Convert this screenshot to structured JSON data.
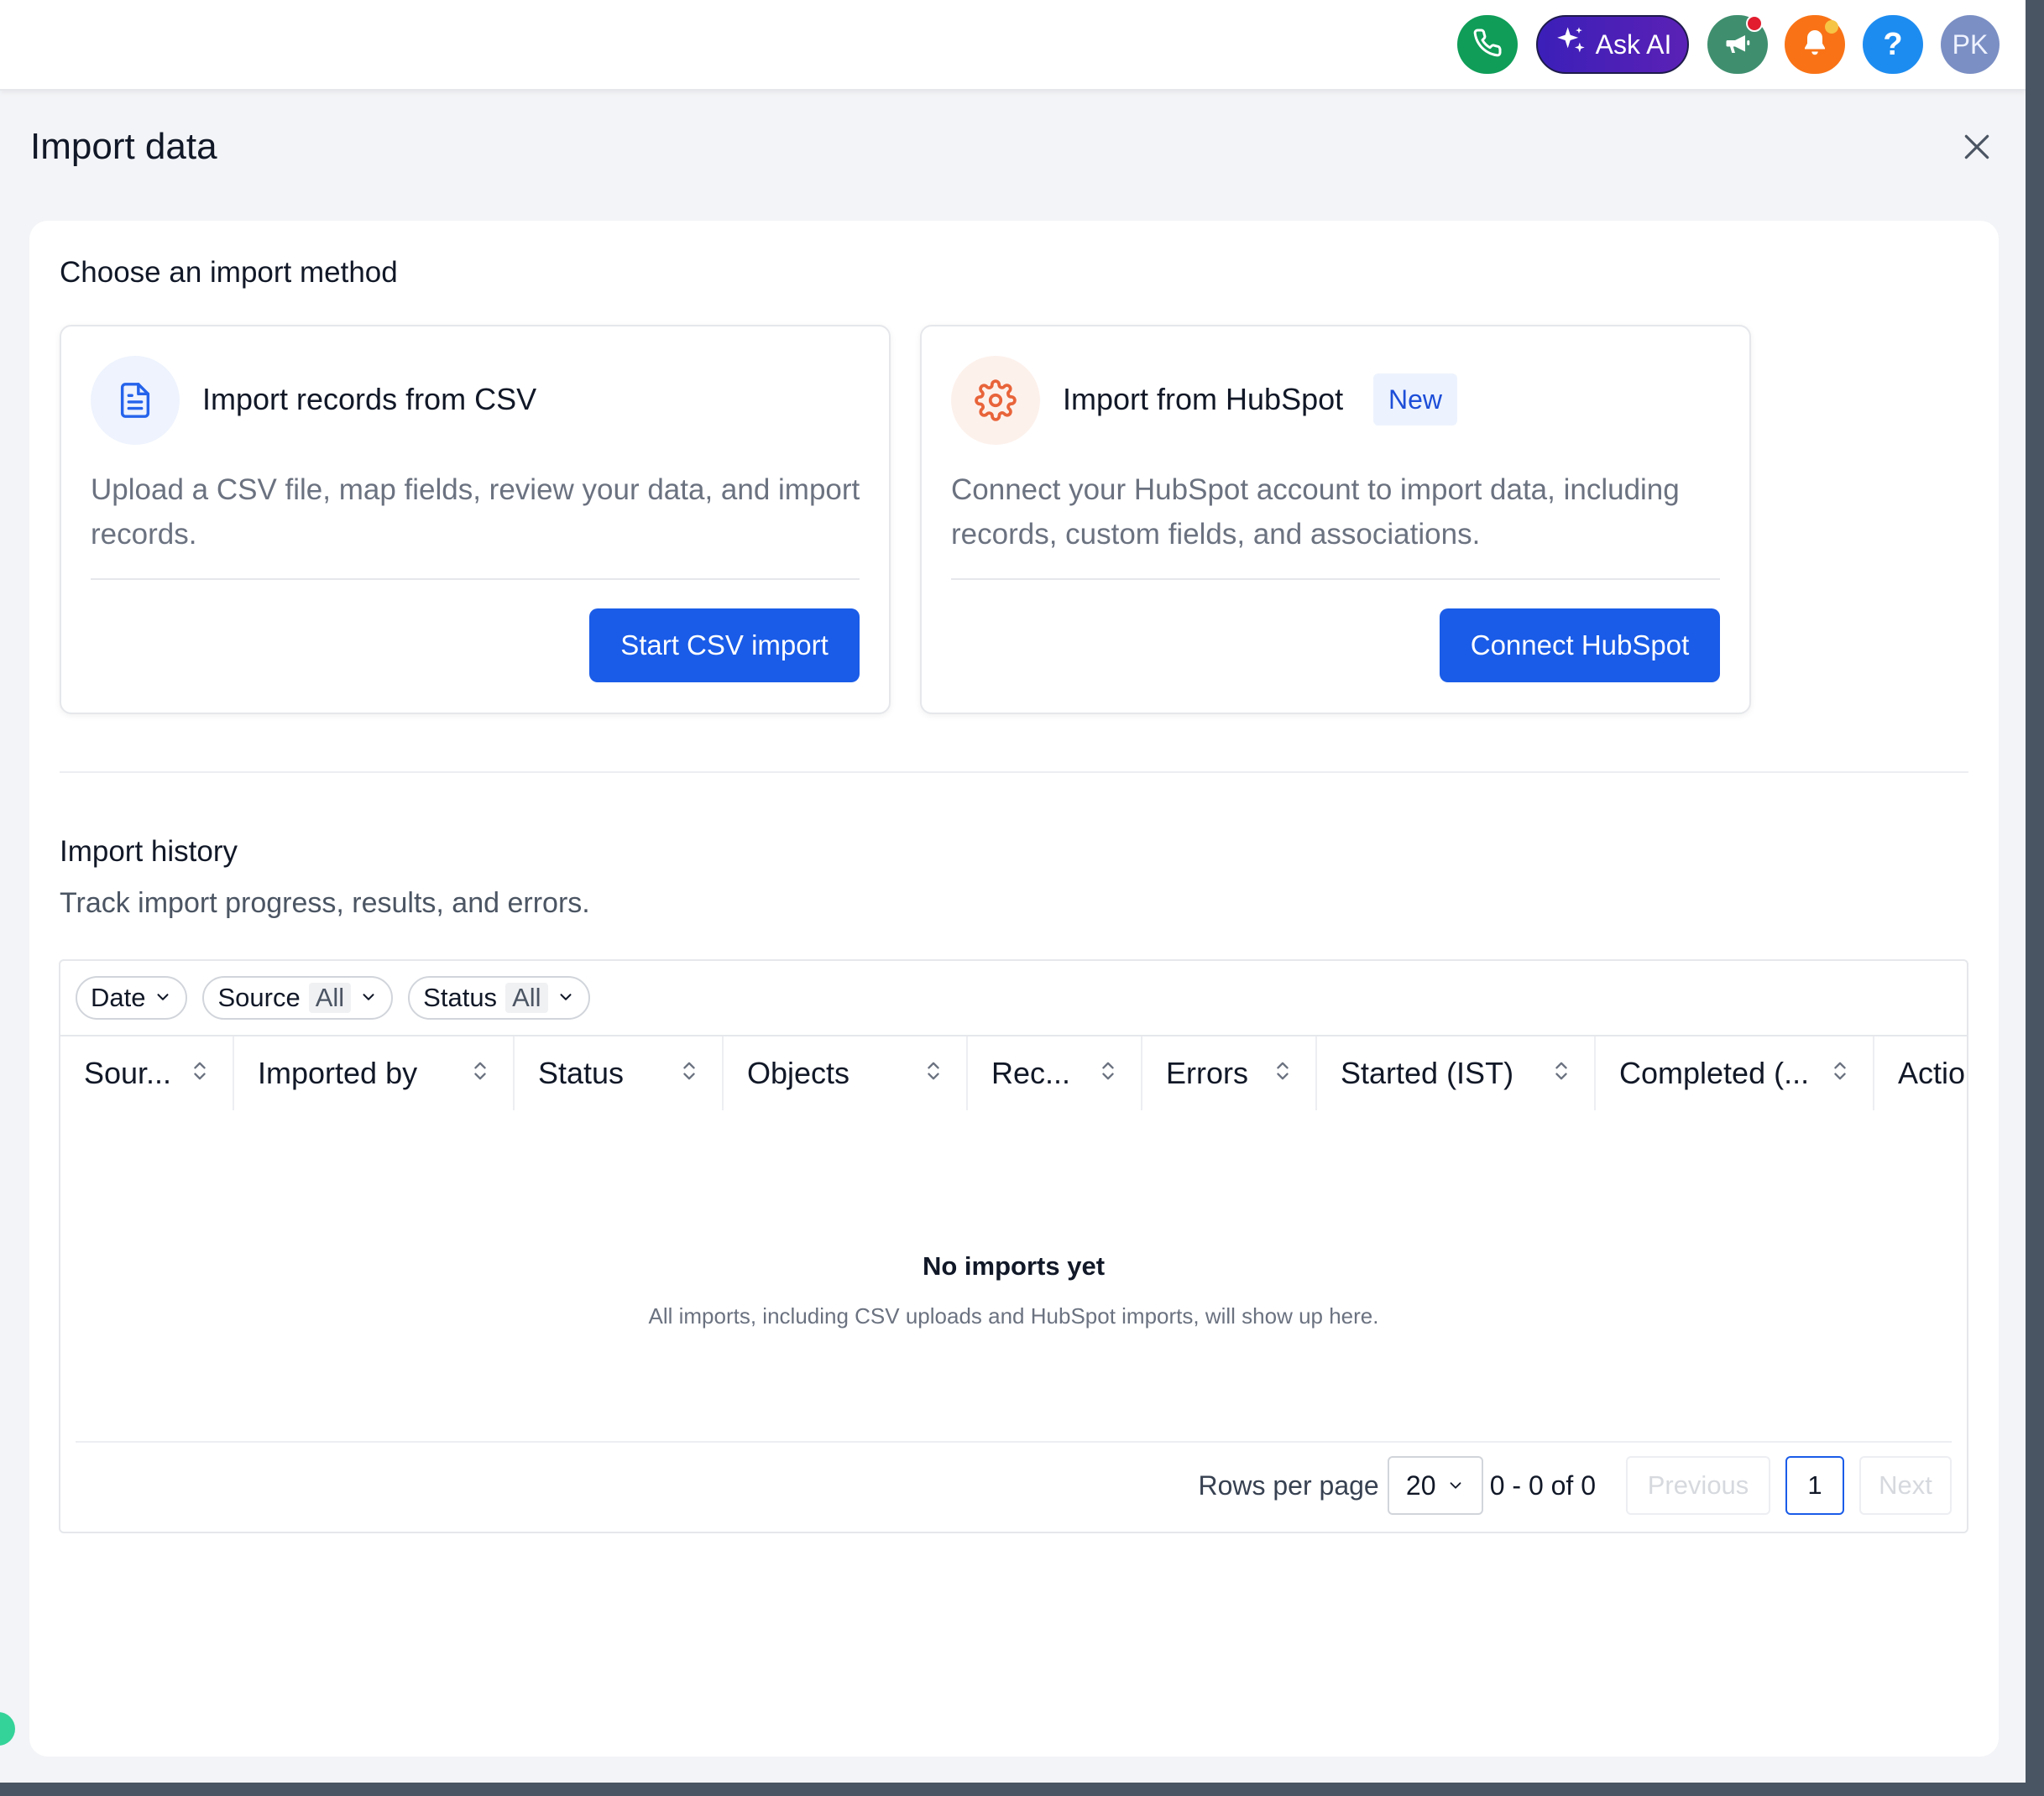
{
  "topbar": {
    "ask_ai_label": "Ask AI",
    "help_label": "?",
    "avatar_initials": "PK"
  },
  "page": {
    "title": "Import data"
  },
  "import_method": {
    "title": "Choose an import method",
    "csv": {
      "title": "Import records from CSV",
      "description": "Upload a CSV file, map fields, review your data, and import records.",
      "button": "Start CSV import"
    },
    "hubspot": {
      "title": "Import from HubSpot",
      "badge": "New",
      "description": "Connect your HubSpot account to import data, including records, custom fields, and associations.",
      "button": "Connect HubSpot"
    }
  },
  "history": {
    "title": "Import history",
    "subtitle": "Track import progress, results, and errors.",
    "filters": [
      {
        "label": "Date",
        "value": ""
      },
      {
        "label": "Source",
        "value": "All"
      },
      {
        "label": "Status",
        "value": "All"
      }
    ],
    "columns": [
      "Sour...",
      "Imported by",
      "Status",
      "Objects",
      "Rec...",
      "Errors",
      "Started (IST)",
      "Completed (...",
      "Actio"
    ],
    "empty_title": "No imports yet",
    "empty_subtitle": "All imports, including CSV uploads and HubSpot imports, will show up here.",
    "pagination": {
      "rows_label": "Rows per page",
      "rows_value": "20",
      "range": "0 - 0 of 0",
      "previous": "Previous",
      "page": "1",
      "next": "Next"
    }
  },
  "colors": {
    "primary": "#1a5ce8",
    "phone": "#0f9d58",
    "ask_ai": "#4c1d95",
    "megaphone": "#3f8f6f",
    "bell": "#f97316",
    "help": "#1d8cf0",
    "avatar": "#7b8fc4"
  }
}
